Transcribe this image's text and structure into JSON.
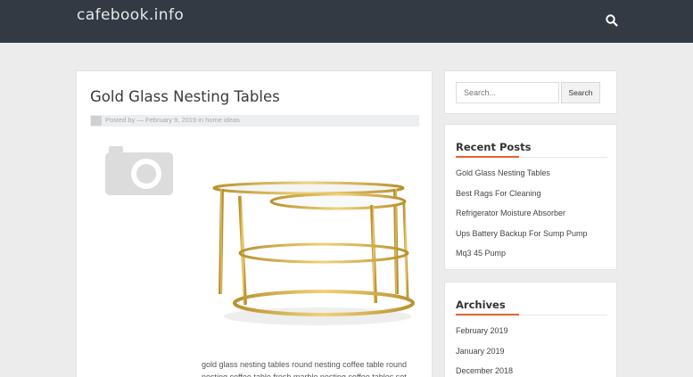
{
  "header": {
    "site_title": "cafebook.info",
    "search_icon": "search-icon"
  },
  "post": {
    "title": "Gold Glass Nesting Tables",
    "meta": "Posted by — February 9, 2019 in home ideas",
    "placeholder_icon": "camera-icon",
    "excerpt": "gold glass nesting tables round nesting coffee table round nesting coffee table fresh marble nesting coffee tables set"
  },
  "sidebar": {
    "search": {
      "placeholder": "Search...",
      "button_label": "Search"
    },
    "recent_posts": {
      "title": "Recent Posts",
      "items": [
        "Gold Glass Nesting Tables",
        "Best Rags For Cleaning",
        "Refrigerator Moisture Absorber",
        "Ups Battery Backup For Sump Pump",
        "Mq3 45 Pump"
      ]
    },
    "archives": {
      "title": "Archives",
      "items": [
        "February 2019",
        "January 2019",
        "December 2018"
      ]
    }
  },
  "colors": {
    "header_bg": "#343a43",
    "accent": "#e0662c",
    "page_bg": "#ececec"
  }
}
